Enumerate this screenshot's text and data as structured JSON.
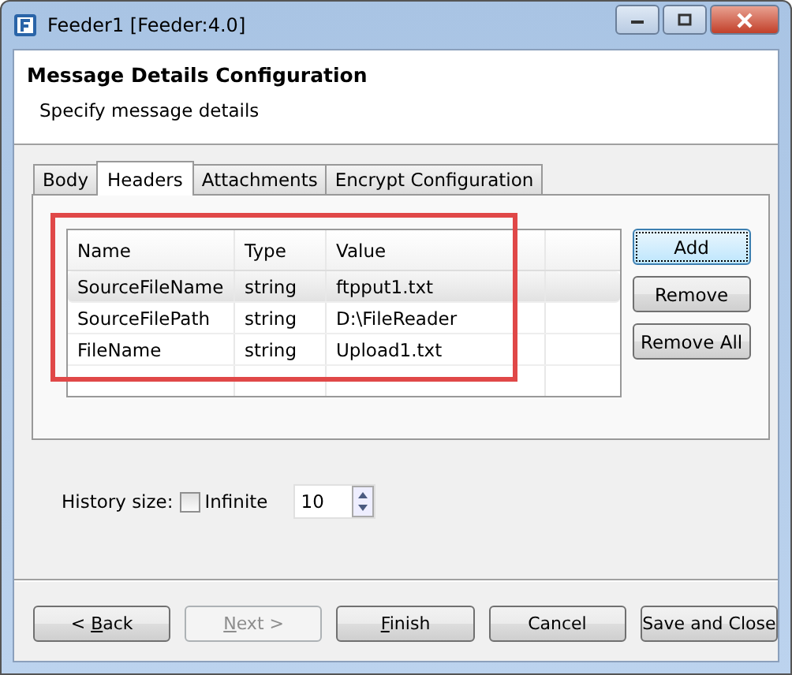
{
  "window": {
    "title": "Feeder1 [Feeder:4.0]"
  },
  "header": {
    "title": "Message Details Configuration",
    "subtitle": "Specify message details"
  },
  "tabs": [
    {
      "label": "Body",
      "selected": false
    },
    {
      "label": "Headers",
      "selected": true
    },
    {
      "label": "Attachments",
      "selected": false
    },
    {
      "label": "Encrypt Configuration",
      "selected": false
    }
  ],
  "table": {
    "columns": [
      "Name",
      "Type",
      "Value"
    ],
    "rows": [
      {
        "cells": [
          "SourceFileName",
          "string",
          "ftpput1.txt"
        ],
        "selected": true
      },
      {
        "cells": [
          "SourceFilePath",
          "string",
          "D:\\FileReader"
        ],
        "selected": false
      },
      {
        "cells": [
          "FileName",
          "string",
          "Upload1.txt"
        ],
        "selected": false
      }
    ]
  },
  "side_buttons": [
    {
      "label": "Add",
      "focused": true
    },
    {
      "label": "Remove",
      "focused": false
    },
    {
      "label": "Remove All",
      "focused": false
    }
  ],
  "history": {
    "label": "History size:",
    "infinite_label": "Infinite",
    "infinite_checked": false,
    "value": "10"
  },
  "footer_buttons": [
    {
      "label_before": "< ",
      "mnemonic": "B",
      "label_after": "ack",
      "disabled": false
    },
    {
      "mnemonic": "N",
      "label_after": "ext >",
      "disabled": true
    },
    {
      "mnemonic": "F",
      "label_after": "inish",
      "disabled": false
    },
    {
      "label_before": "Cancel",
      "disabled": false
    },
    {
      "label_before": "Save and Close",
      "disabled": false
    }
  ]
}
